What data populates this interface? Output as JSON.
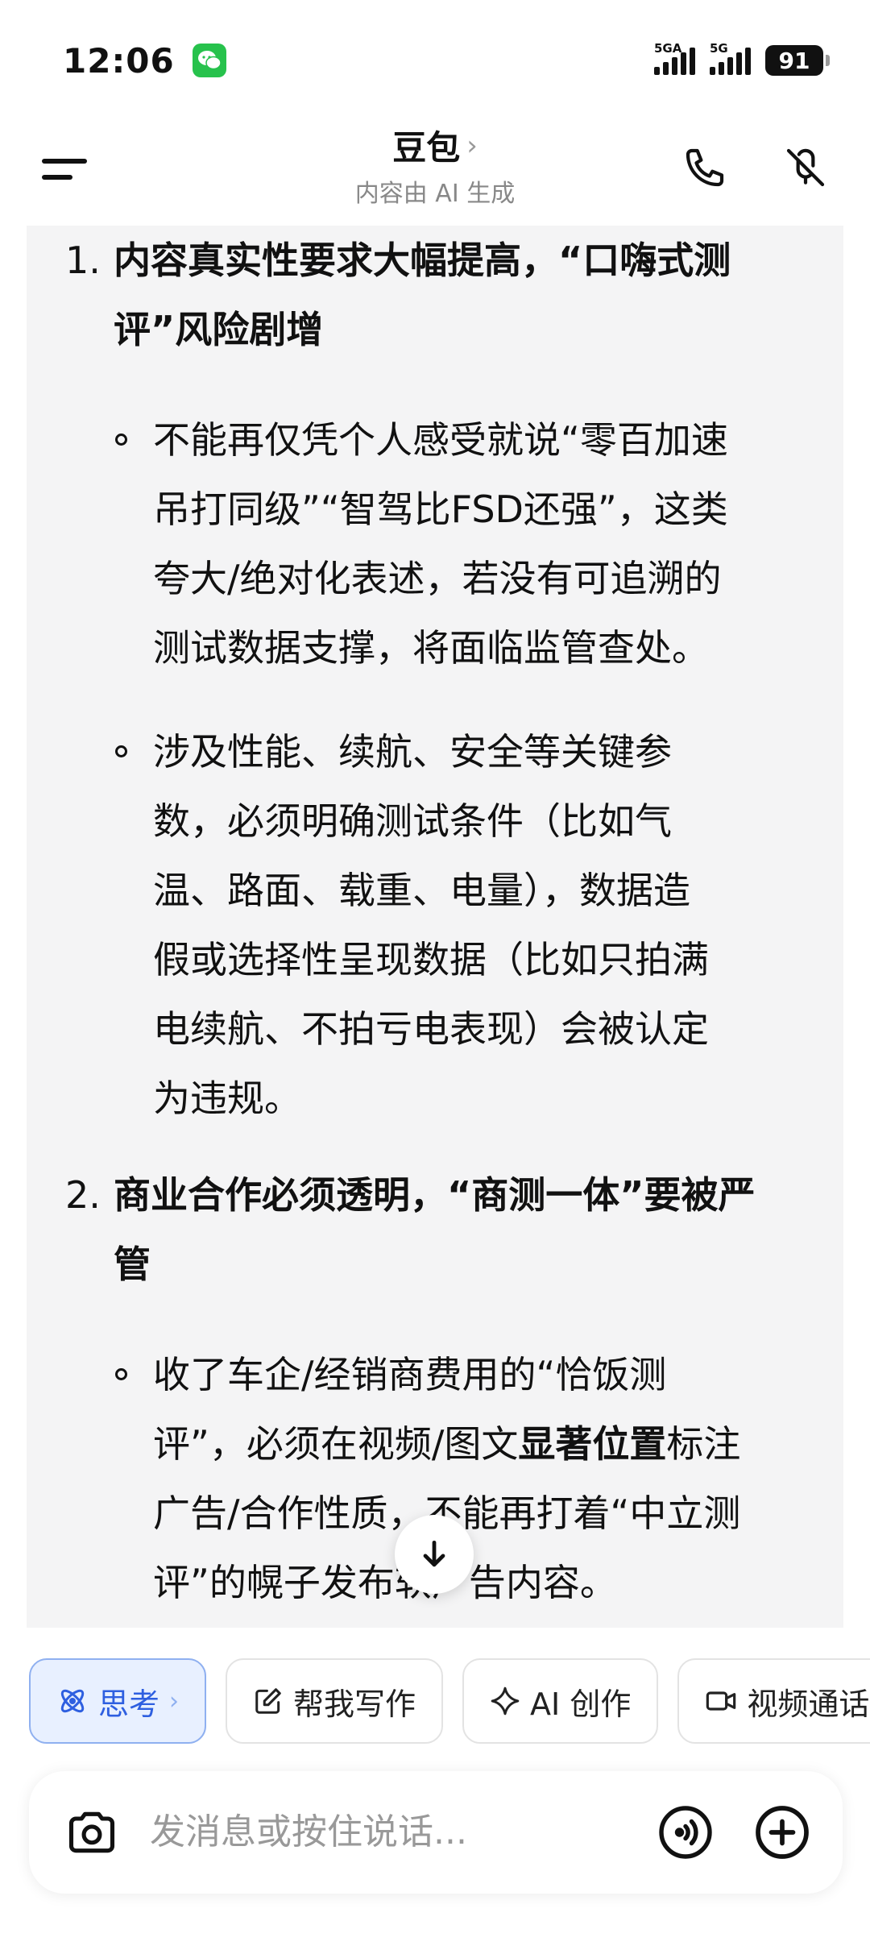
{
  "status_bar": {
    "time": "12:06",
    "signal1_label": "5GA",
    "signal2_label": "5G",
    "battery": "91"
  },
  "header": {
    "title": "豆包",
    "title_chevron": "›",
    "subtitle": "内容由 AI 生成"
  },
  "content": {
    "item1": {
      "number": "1.",
      "heading_line1": "内容真实性要求大幅提高，“口嗨式测",
      "heading_line2": "评”风险剧增",
      "bullets": [
        {
          "lines": [
            "不能再仅凭个人感受就说“零百加速",
            "吊打同级”“智驾比FSD还强”，这类",
            "夸大/绝对化表述，若没有可追溯的",
            "测试数据支撑，将面临监管查处。"
          ]
        },
        {
          "lines": [
            "涉及性能、续航、安全等关键参",
            "数，必须明确测试条件（比如气",
            "温、路面、载重、电量），数据造",
            "假或选择性呈现数据（比如只拍满",
            "电续航、不拍亏电表现）会被认定",
            "为违规。"
          ]
        }
      ]
    },
    "item2": {
      "number": "2.",
      "heading_line1": "商业合作必须透明，“商测一体”要被严",
      "heading_line2": "管",
      "bullet": {
        "line1": "收了车企/经销商费用的“恰饭测",
        "line2_pre": "评”，必须在视频/图文",
        "line2_bold": "显著位置",
        "line2_post": "标注",
        "line3": "广告/合作性质，不能再打着“中立测",
        "line4": "评”的幌子发布软广告内容。"
      }
    }
  },
  "chips": [
    {
      "label": "思考",
      "chevron": "›",
      "icon": "atom-icon",
      "active": true
    },
    {
      "label": "帮我写作",
      "icon": "edit-icon"
    },
    {
      "label": "AI 创作",
      "icon": "sparkle-icon"
    },
    {
      "label": "视频通话",
      "icon": "video-icon"
    }
  ],
  "input": {
    "placeholder": "发消息或按住说话..."
  },
  "colors": {
    "accent": "#2e5fe0",
    "wechat_green": "#27c24c",
    "card_bg": "#f4f4f5"
  }
}
